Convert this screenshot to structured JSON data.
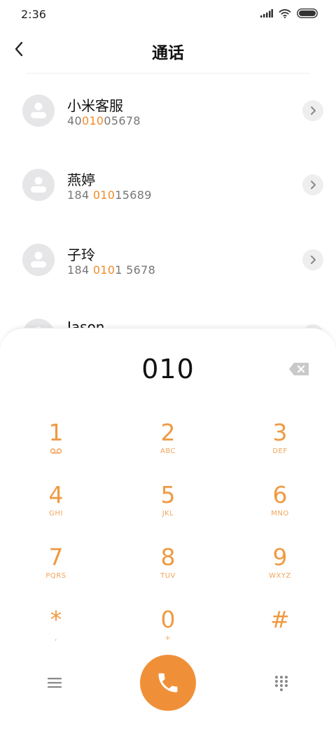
{
  "status": {
    "time": "2:36"
  },
  "header": {
    "title": "通话"
  },
  "contacts": [
    {
      "name": "小米客服",
      "num_pre": "40",
      "num_hl": "010",
      "num_post": "05678"
    },
    {
      "name": "燕婷",
      "num_pre": "184 ",
      "num_hl": "010",
      "num_post": "15689"
    },
    {
      "name": "子玲",
      "num_pre": "184 ",
      "num_hl": "010",
      "num_post": "1 5678"
    },
    {
      "name": "Jason",
      "num_pre": "",
      "num_hl": "",
      "num_post": ""
    }
  ],
  "dialer": {
    "input": "010",
    "keys": [
      {
        "num": "1",
        "sub": ""
      },
      {
        "num": "2",
        "sub": "ABC"
      },
      {
        "num": "3",
        "sub": "DEF"
      },
      {
        "num": "4",
        "sub": "GHI"
      },
      {
        "num": "5",
        "sub": "JKL"
      },
      {
        "num": "6",
        "sub": "MNO"
      },
      {
        "num": "7",
        "sub": "PQRS"
      },
      {
        "num": "8",
        "sub": "TUV"
      },
      {
        "num": "9",
        "sub": "WXYZ"
      },
      {
        "num": "*",
        "sub": ","
      },
      {
        "num": "0",
        "sub": "+"
      },
      {
        "num": "#",
        "sub": ""
      }
    ]
  },
  "colors": {
    "accent": "#ef9039",
    "highlight": "#ef8b2a"
  },
  "icons": [
    "back-arrow-icon",
    "signal-icon",
    "wifi-icon",
    "battery-icon",
    "chevron-right-icon",
    "backspace-icon",
    "voicemail-icon",
    "menu-icon",
    "call-icon",
    "dialpad-icon"
  ]
}
